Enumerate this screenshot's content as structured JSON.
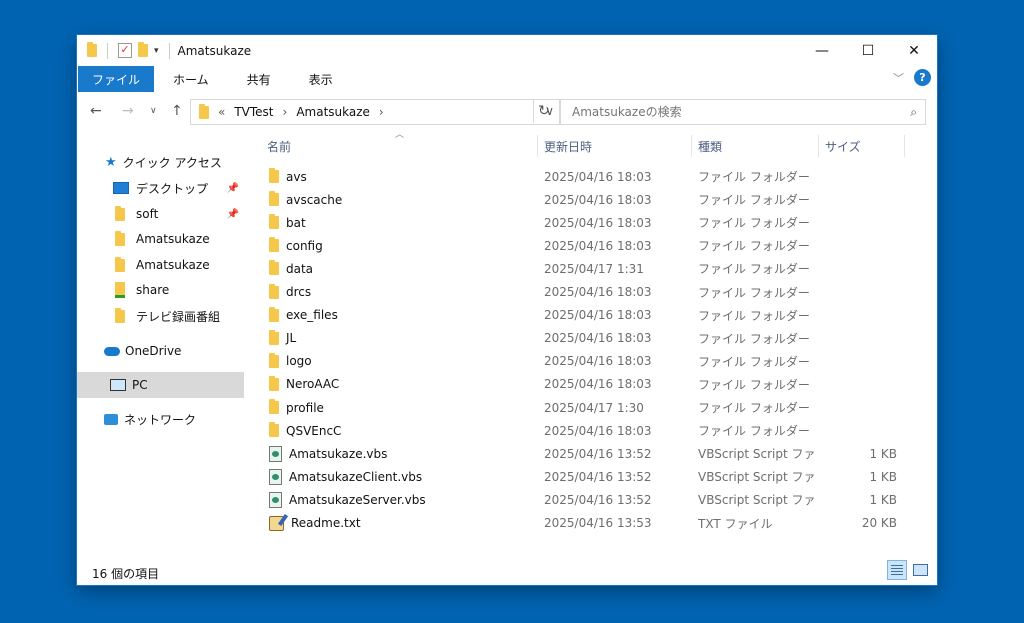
{
  "window": {
    "title": "Amatsukaze",
    "controls": {
      "minimize": "—",
      "maximize": "☐",
      "close": "✕"
    }
  },
  "ribbon": {
    "tabs": [
      "ファイル",
      "ホーム",
      "共有",
      "表示"
    ],
    "collapse_icon": "chevron-down-icon",
    "help": "?"
  },
  "address": {
    "overflow": "«",
    "crumbs": [
      "TVTest",
      "Amatsukaze"
    ],
    "separator": "›"
  },
  "search": {
    "placeholder": "Amatsukazeの検索"
  },
  "nav": {
    "quick_access": "クイック アクセス",
    "items": [
      {
        "label": "デスクトップ",
        "icon": "desktop-icon",
        "pinned": true
      },
      {
        "label": "soft",
        "icon": "folder-icon",
        "pinned": true
      },
      {
        "label": "Amatsukaze",
        "icon": "folder-icon",
        "pinned": false
      },
      {
        "label": "Amatsukaze",
        "icon": "folder-icon",
        "pinned": false
      },
      {
        "label": "share",
        "icon": "shared-folder-icon",
        "pinned": false
      },
      {
        "label": "テレビ録画番組",
        "icon": "folder-icon",
        "pinned": false
      }
    ],
    "onedrive": "OneDrive",
    "pc": "PC",
    "network": "ネットワーク"
  },
  "columns": {
    "name": "名前",
    "date": "更新日時",
    "type": "種類",
    "size": "サイズ"
  },
  "files": [
    {
      "name": "avs",
      "date": "2025/04/16 18:03",
      "type": "ファイル フォルダー",
      "size": "",
      "icon": "folder"
    },
    {
      "name": "avscache",
      "date": "2025/04/16 18:03",
      "type": "ファイル フォルダー",
      "size": "",
      "icon": "folder"
    },
    {
      "name": "bat",
      "date": "2025/04/16 18:03",
      "type": "ファイル フォルダー",
      "size": "",
      "icon": "folder"
    },
    {
      "name": "config",
      "date": "2025/04/16 18:03",
      "type": "ファイル フォルダー",
      "size": "",
      "icon": "folder"
    },
    {
      "name": "data",
      "date": "2025/04/17 1:31",
      "type": "ファイル フォルダー",
      "size": "",
      "icon": "folder"
    },
    {
      "name": "drcs",
      "date": "2025/04/16 18:03",
      "type": "ファイル フォルダー",
      "size": "",
      "icon": "folder"
    },
    {
      "name": "exe_files",
      "date": "2025/04/16 18:03",
      "type": "ファイル フォルダー",
      "size": "",
      "icon": "folder"
    },
    {
      "name": "JL",
      "date": "2025/04/16 18:03",
      "type": "ファイル フォルダー",
      "size": "",
      "icon": "folder"
    },
    {
      "name": "logo",
      "date": "2025/04/16 18:03",
      "type": "ファイル フォルダー",
      "size": "",
      "icon": "folder"
    },
    {
      "name": "NeroAAC",
      "date": "2025/04/16 18:03",
      "type": "ファイル フォルダー",
      "size": "",
      "icon": "folder"
    },
    {
      "name": "profile",
      "date": "2025/04/17 1:30",
      "type": "ファイル フォルダー",
      "size": "",
      "icon": "folder"
    },
    {
      "name": "QSVEncC",
      "date": "2025/04/16 18:03",
      "type": "ファイル フォルダー",
      "size": "",
      "icon": "folder"
    },
    {
      "name": "Amatsukaze.vbs",
      "date": "2025/04/16 13:52",
      "type": "VBScript Script ファ...",
      "size": "1 KB",
      "icon": "vbs"
    },
    {
      "name": "AmatsukazeClient.vbs",
      "date": "2025/04/16 13:52",
      "type": "VBScript Script ファ...",
      "size": "1 KB",
      "icon": "vbs"
    },
    {
      "name": "AmatsukazeServer.vbs",
      "date": "2025/04/16 13:52",
      "type": "VBScript Script ファ...",
      "size": "1 KB",
      "icon": "vbs"
    },
    {
      "name": "Readme.txt",
      "date": "2025/04/16 13:53",
      "type": "TXT ファイル",
      "size": "20 KB",
      "icon": "txt"
    }
  ],
  "status": {
    "count": "16 個の項目"
  },
  "colors": {
    "desktop_bg": "#0063b1",
    "accent": "#1979ca",
    "folder": "#f5c84c"
  }
}
